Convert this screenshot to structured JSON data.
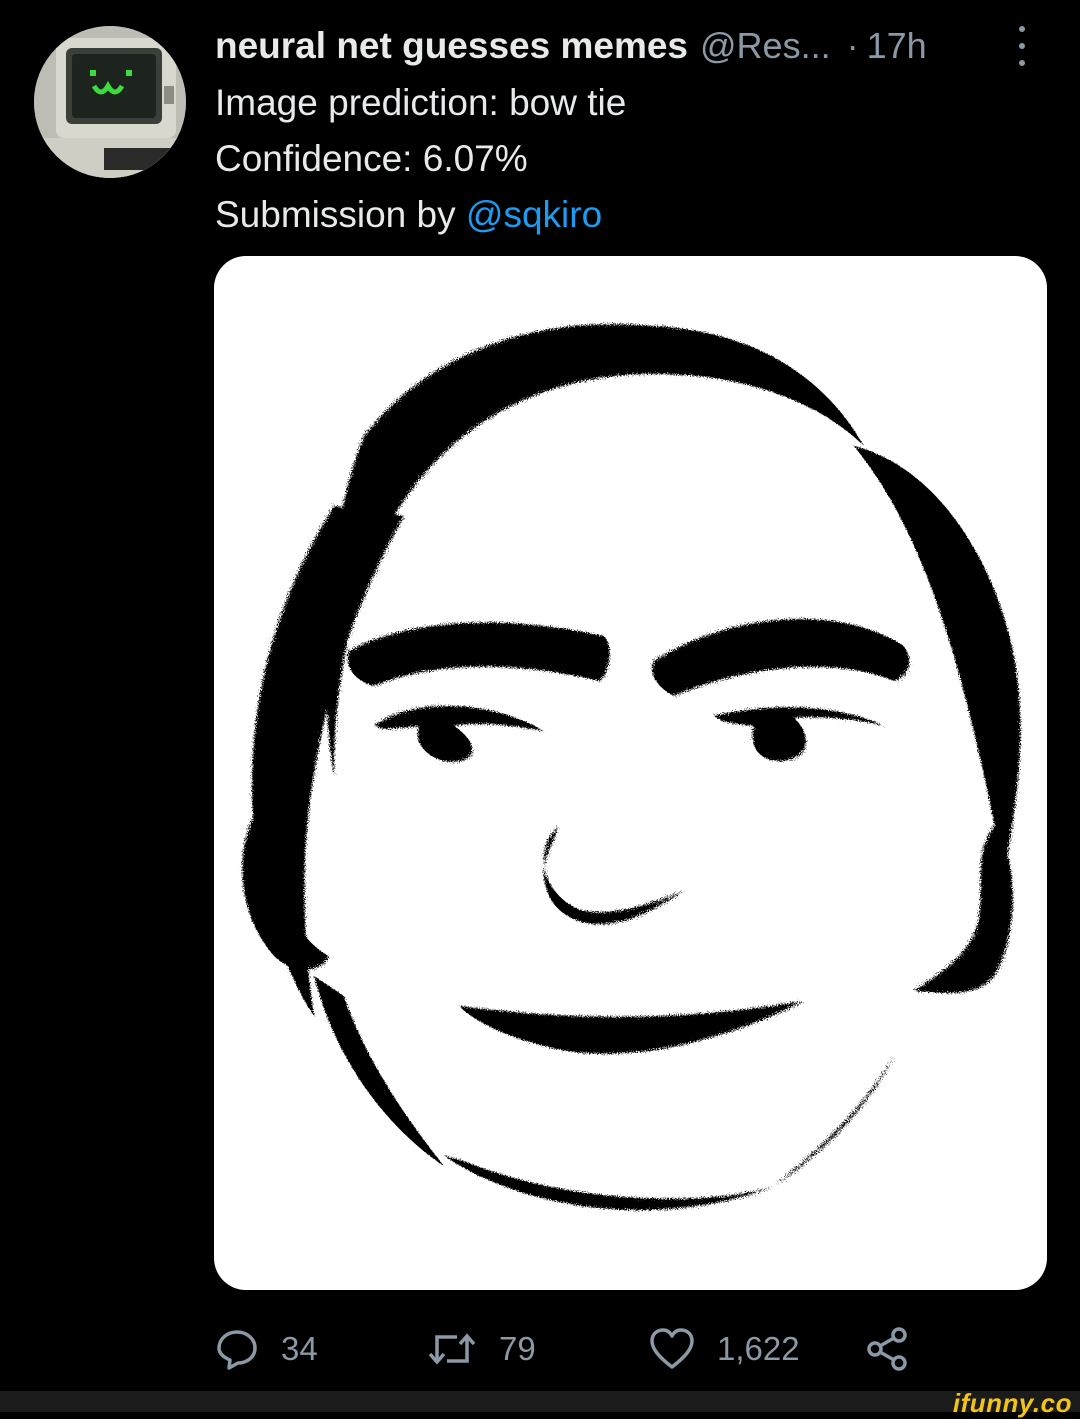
{
  "tweet": {
    "display_name": "neural net guesses memes",
    "handle": "@Res...",
    "separator": "·",
    "time": "17h",
    "lines": {
      "prediction": "Image prediction: bow tie",
      "confidence": "Confidence: 6.07%",
      "submission_prefix": "Submission by",
      "submission_mention": "@sqkiro"
    }
  },
  "actions": {
    "replies": "34",
    "retweets": "79",
    "likes": "1,622"
  },
  "watermark": "ifunny.co",
  "colors": {
    "background": "#000000",
    "text": "#e7e9ea",
    "secondary": "#8b98a5",
    "link": "#1d9bf0",
    "avatar_face": "#3ddc3d",
    "watermark": "#f3c318"
  },
  "icons": {
    "avatar": "retro-computer-avatar",
    "reply": "speech-bubble-icon",
    "retweet": "retweet-icon",
    "like": "heart-icon",
    "share": "share-icon",
    "more": "vertical-dots-icon"
  }
}
